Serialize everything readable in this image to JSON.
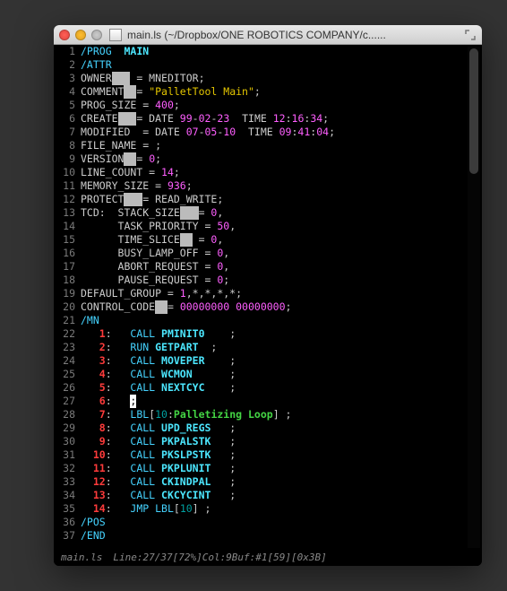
{
  "window": {
    "title": "main.ls (~/Dropbox/ONE ROBOTICS COMPANY/c......"
  },
  "status": {
    "file": "main.ls",
    "info": "Line:27/37[72%]Col:9Buf:#1[59][0x3B]"
  },
  "gutter": {
    "count": 37
  },
  "code": {
    "lines": [
      [
        {
          "c": "c-cyan",
          "t": "/PROG  "
        },
        {
          "c": "c-bcyan",
          "t": "MAIN"
        }
      ],
      [
        {
          "c": "c-cyan",
          "t": "/ATTR"
        }
      ],
      [
        {
          "c": "c-comment",
          "t": "OWNER"
        },
        {
          "c": "c-hilite",
          "t": "   "
        },
        {
          "c": "c-comment",
          "t": " = MNEDITOR;"
        }
      ],
      [
        {
          "c": "c-comment",
          "t": "COMMENT"
        },
        {
          "c": "c-hilite",
          "t": "  "
        },
        {
          "c": "c-comment",
          "t": "= "
        },
        {
          "c": "c-yellow",
          "t": "\"PalletTool Main\""
        },
        {
          "c": "c-comment",
          "t": ";"
        }
      ],
      [
        {
          "c": "c-comment",
          "t": "PROG_SIZE = "
        },
        {
          "c": "c-magenta",
          "t": "400"
        },
        {
          "c": "c-comment",
          "t": ";"
        }
      ],
      [
        {
          "c": "c-comment",
          "t": "CREATE"
        },
        {
          "c": "c-hilite",
          "t": "   "
        },
        {
          "c": "c-comment",
          "t": "= DATE "
        },
        {
          "c": "c-magenta",
          "t": "99"
        },
        {
          "c": "c-comment",
          "t": "-"
        },
        {
          "c": "c-magenta",
          "t": "02"
        },
        {
          "c": "c-comment",
          "t": "-"
        },
        {
          "c": "c-magenta",
          "t": "23"
        },
        {
          "c": "c-comment",
          "t": "  TIME "
        },
        {
          "c": "c-magenta",
          "t": "12"
        },
        {
          "c": "c-comment",
          "t": ":"
        },
        {
          "c": "c-magenta",
          "t": "16"
        },
        {
          "c": "c-comment",
          "t": ":"
        },
        {
          "c": "c-magenta",
          "t": "34"
        },
        {
          "c": "c-comment",
          "t": ";"
        }
      ],
      [
        {
          "c": "c-comment",
          "t": "MODIFIED  = DATE "
        },
        {
          "c": "c-magenta",
          "t": "07"
        },
        {
          "c": "c-comment",
          "t": "-"
        },
        {
          "c": "c-magenta",
          "t": "05"
        },
        {
          "c": "c-comment",
          "t": "-"
        },
        {
          "c": "c-magenta",
          "t": "10"
        },
        {
          "c": "c-comment",
          "t": "  TIME "
        },
        {
          "c": "c-magenta",
          "t": "09"
        },
        {
          "c": "c-comment",
          "t": ":"
        },
        {
          "c": "c-magenta",
          "t": "41"
        },
        {
          "c": "c-comment",
          "t": ":"
        },
        {
          "c": "c-magenta",
          "t": "04"
        },
        {
          "c": "c-comment",
          "t": ";"
        }
      ],
      [
        {
          "c": "c-comment",
          "t": "FILE_NAME = ;"
        }
      ],
      [
        {
          "c": "c-comment",
          "t": "VERSION"
        },
        {
          "c": "c-hilite",
          "t": "  "
        },
        {
          "c": "c-comment",
          "t": "= "
        },
        {
          "c": "c-magenta",
          "t": "0"
        },
        {
          "c": "c-comment",
          "t": ";"
        }
      ],
      [
        {
          "c": "c-comment",
          "t": "LINE_COUNT = "
        },
        {
          "c": "c-magenta",
          "t": "14"
        },
        {
          "c": "c-comment",
          "t": ";"
        }
      ],
      [
        {
          "c": "c-comment",
          "t": "MEMORY_SIZE = "
        },
        {
          "c": "c-magenta",
          "t": "936"
        },
        {
          "c": "c-comment",
          "t": ";"
        }
      ],
      [
        {
          "c": "c-comment",
          "t": "PROTECT"
        },
        {
          "c": "c-hilite",
          "t": "   "
        },
        {
          "c": "c-comment",
          "t": "= READ_WRITE;"
        }
      ],
      [
        {
          "c": "c-comment",
          "t": "TCD:  STACK_SIZE"
        },
        {
          "c": "c-hilite",
          "t": "   "
        },
        {
          "c": "c-comment",
          "t": "= "
        },
        {
          "c": "c-magenta",
          "t": "0"
        },
        {
          "c": "c-comment",
          "t": ","
        }
      ],
      [
        {
          "c": "c-comment",
          "t": "      TASK_PRIORITY = "
        },
        {
          "c": "c-magenta",
          "t": "50"
        },
        {
          "c": "c-comment",
          "t": ","
        }
      ],
      [
        {
          "c": "c-comment",
          "t": "      TIME_SLICE"
        },
        {
          "c": "c-hilite",
          "t": "  "
        },
        {
          "c": "c-comment",
          "t": " = "
        },
        {
          "c": "c-magenta",
          "t": "0"
        },
        {
          "c": "c-comment",
          "t": ","
        }
      ],
      [
        {
          "c": "c-comment",
          "t": "      BUSY_LAMP_OFF = "
        },
        {
          "c": "c-magenta",
          "t": "0"
        },
        {
          "c": "c-comment",
          "t": ","
        }
      ],
      [
        {
          "c": "c-comment",
          "t": "      ABORT_REQUEST = "
        },
        {
          "c": "c-magenta",
          "t": "0"
        },
        {
          "c": "c-comment",
          "t": ","
        }
      ],
      [
        {
          "c": "c-comment",
          "t": "      PAUSE_REQUEST = "
        },
        {
          "c": "c-magenta",
          "t": "0"
        },
        {
          "c": "c-comment",
          "t": ";"
        }
      ],
      [
        {
          "c": "c-comment",
          "t": "DEFAULT_GROUP = "
        },
        {
          "c": "c-magenta",
          "t": "1"
        },
        {
          "c": "c-comment",
          "t": ",*,*,*,*;"
        }
      ],
      [
        {
          "c": "c-comment",
          "t": "CONTROL_CODE"
        },
        {
          "c": "c-hilite",
          "t": "  "
        },
        {
          "c": "c-comment",
          "t": "= "
        },
        {
          "c": "c-magenta",
          "t": "00000000 00000000"
        },
        {
          "c": "c-comment",
          "t": ";"
        }
      ],
      [
        {
          "c": "c-cyan",
          "t": "/MN"
        }
      ],
      [
        {
          "c": "c-red",
          "t": "   1"
        },
        {
          "c": "c-comment",
          "t": ":   "
        },
        {
          "c": "c-cyan",
          "t": "CALL"
        },
        {
          "c": "c-bcyan",
          "t": " PMINIT0    "
        },
        {
          "c": "c-comment",
          "t": ";"
        }
      ],
      [
        {
          "c": "c-red",
          "t": "   2"
        },
        {
          "c": "c-comment",
          "t": ":   "
        },
        {
          "c": "c-cyan",
          "t": "RUN "
        },
        {
          "c": "c-bcyan",
          "t": "GETPART  "
        },
        {
          "c": "c-comment",
          "t": ";"
        }
      ],
      [
        {
          "c": "c-red",
          "t": "   3"
        },
        {
          "c": "c-comment",
          "t": ":   "
        },
        {
          "c": "c-cyan",
          "t": "CALL"
        },
        {
          "c": "c-bcyan",
          "t": " MOVEPER    "
        },
        {
          "c": "c-comment",
          "t": ";"
        }
      ],
      [
        {
          "c": "c-red",
          "t": "   4"
        },
        {
          "c": "c-comment",
          "t": ":   "
        },
        {
          "c": "c-cyan",
          "t": "CALL"
        },
        {
          "c": "c-bcyan",
          "t": " WCMON      "
        },
        {
          "c": "c-comment",
          "t": ";"
        }
      ],
      [
        {
          "c": "c-red",
          "t": "   5"
        },
        {
          "c": "c-comment",
          "t": ":   "
        },
        {
          "c": "c-cyan",
          "t": "CALL"
        },
        {
          "c": "c-bcyan",
          "t": " NEXTCYC    "
        },
        {
          "c": "c-comment",
          "t": ";"
        }
      ],
      [
        {
          "c": "c-red",
          "t": "   6"
        },
        {
          "c": "c-comment",
          "t": ":   "
        },
        {
          "c": "c-cursor",
          "t": ";"
        }
      ],
      [
        {
          "c": "c-red",
          "t": "   7"
        },
        {
          "c": "c-comment",
          "t": ":   "
        },
        {
          "c": "c-cyan",
          "t": "LBL"
        },
        {
          "c": "c-comment",
          "t": "["
        },
        {
          "c": "c-dteal",
          "t": "10"
        },
        {
          "c": "c-comment",
          "t": ":"
        },
        {
          "c": "c-green",
          "t": "Palletizing Loop"
        },
        {
          "c": "c-comment",
          "t": "] ;"
        }
      ],
      [
        {
          "c": "c-red",
          "t": "   8"
        },
        {
          "c": "c-comment",
          "t": ":   "
        },
        {
          "c": "c-cyan",
          "t": "CALL"
        },
        {
          "c": "c-bcyan",
          "t": " UPD_REGS   "
        },
        {
          "c": "c-comment",
          "t": ";"
        }
      ],
      [
        {
          "c": "c-red",
          "t": "   9"
        },
        {
          "c": "c-comment",
          "t": ":   "
        },
        {
          "c": "c-cyan",
          "t": "CALL"
        },
        {
          "c": "c-bcyan",
          "t": " PKPALSTK   "
        },
        {
          "c": "c-comment",
          "t": ";"
        }
      ],
      [
        {
          "c": "c-red",
          "t": "  10"
        },
        {
          "c": "c-comment",
          "t": ":   "
        },
        {
          "c": "c-cyan",
          "t": "CALL"
        },
        {
          "c": "c-bcyan",
          "t": " PKSLPSTK   "
        },
        {
          "c": "c-comment",
          "t": ";"
        }
      ],
      [
        {
          "c": "c-red",
          "t": "  11"
        },
        {
          "c": "c-comment",
          "t": ":   "
        },
        {
          "c": "c-cyan",
          "t": "CALL"
        },
        {
          "c": "c-bcyan",
          "t": " PKPLUNIT   "
        },
        {
          "c": "c-comment",
          "t": ";"
        }
      ],
      [
        {
          "c": "c-red",
          "t": "  12"
        },
        {
          "c": "c-comment",
          "t": ":   "
        },
        {
          "c": "c-cyan",
          "t": "CALL"
        },
        {
          "c": "c-bcyan",
          "t": " CKINDPAL   "
        },
        {
          "c": "c-comment",
          "t": ";"
        }
      ],
      [
        {
          "c": "c-red",
          "t": "  13"
        },
        {
          "c": "c-comment",
          "t": ":   "
        },
        {
          "c": "c-cyan",
          "t": "CALL"
        },
        {
          "c": "c-bcyan",
          "t": " CKCYCINT   "
        },
        {
          "c": "c-comment",
          "t": ";"
        }
      ],
      [
        {
          "c": "c-red",
          "t": "  14"
        },
        {
          "c": "c-comment",
          "t": ":   "
        },
        {
          "c": "c-cyan",
          "t": "JMP LBL"
        },
        {
          "c": "c-comment",
          "t": "["
        },
        {
          "c": "c-dteal",
          "t": "10"
        },
        {
          "c": "c-comment",
          "t": "] ;"
        }
      ],
      [
        {
          "c": "c-cyan",
          "t": "/POS"
        }
      ],
      [
        {
          "c": "c-cyan",
          "t": "/END"
        }
      ]
    ]
  }
}
